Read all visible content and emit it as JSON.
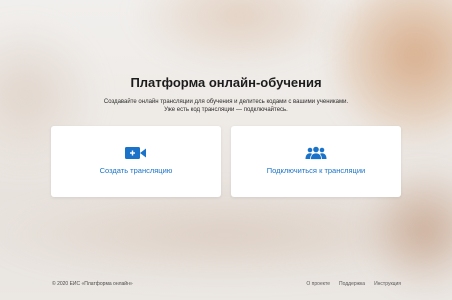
{
  "hero": {
    "title": "Платформа онлайн-обучения",
    "subtitle_line1": "Создавайте онлайн трансляции для обучения и делитесь кодами с вашими учениками.",
    "subtitle_line2": "Уже есть код трансляции — подключайтесь."
  },
  "cards": {
    "create": {
      "label": "Создать трансляцию",
      "icon": "video-camera-icon"
    },
    "join": {
      "label": "Подключиться к трансляции",
      "icon": "group-users-icon"
    }
  },
  "footer": {
    "copyright": "© 2020 ЕИС «Платформа онлайн»",
    "links": [
      "О проекте",
      "Поддержка",
      "Инструкция"
    ]
  },
  "colors": {
    "accent": "#1a73c8",
    "card_bg": "#ffffff",
    "title_text": "#1c1c1c"
  }
}
